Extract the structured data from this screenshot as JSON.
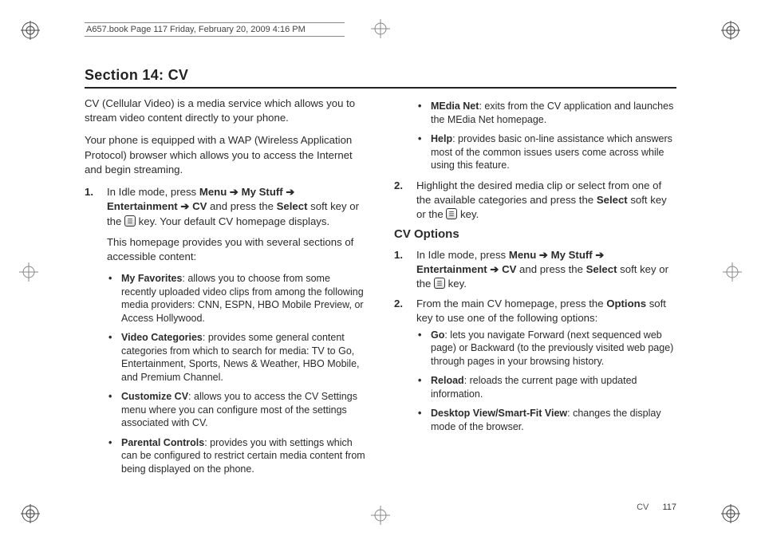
{
  "bookmeta": "A657.book  Page 117  Friday, February 20, 2009  4:16 PM",
  "section_title": "Section 14: CV",
  "intro1": "CV (Cellular Video) is a media service which allows you to stream video content directly to your phone.",
  "intro2": "Your phone is equipped with a WAP (Wireless Application Protocol) browser which allows you to access the Internet and begin streaming.",
  "step1": {
    "lead_a": "In Idle mode, press ",
    "menu": "Menu",
    "arrow": " ➔ ",
    "mystuff": "My Stuff",
    "entertainment": "Entertainment",
    "cv": "CV",
    "lead_b": " and press the ",
    "select": "Select",
    "lead_c": " soft key or the ",
    "lead_d": " key. Your default CV homepage displays.",
    "para2": "This homepage provides you with several sections of accessible content:"
  },
  "bullets_left": [
    {
      "label": "My Favorites",
      "text": ": allows you to choose from some recently uploaded video clips from among the following media providers: CNN, ESPN, HBO Mobile Preview, or Access Hollywood."
    },
    {
      "label": "Video Categories",
      "text": ": provides some general content categories from which to search for media: TV to Go, Entertainment, Sports, News & Weather, HBO Mobile, and Premium Channel."
    },
    {
      "label": "Customize CV",
      "text": ": allows you to access the CV Settings menu where you can configure most of the settings associated with CV."
    },
    {
      "label": "Parental Controls",
      "text": ": provides you with settings which can be configured to restrict certain media content from being displayed on the phone."
    }
  ],
  "bullets_right_top": [
    {
      "label": "MEdia Net",
      "text": ": exits from the CV application and launches the MEdia Net homepage."
    },
    {
      "label": "Help",
      "text": ": provides basic on-line assistance which answers most of the common issues users come across while using this feature."
    }
  ],
  "step2_right": {
    "a": "Highlight the desired media clip or select from one of the available categories and press the ",
    "select": "Select",
    "b": " soft key or the ",
    "c": " key."
  },
  "cv_options_title": "CV Options",
  "cvopt_step1": {
    "a": "In Idle mode, press ",
    "menu": "Menu",
    "arrow": " ➔ ",
    "mystuff": "My Stuff",
    "entertainment": "Entertainment",
    "cv": "CV",
    "b": " and press the ",
    "select": "Select",
    "c": " soft key or the ",
    "d": " key."
  },
  "cvopt_step2": {
    "a": "From the main CV homepage, press the ",
    "options": "Options",
    "b": " soft key to use one of the following options:"
  },
  "bullets_cvopt": [
    {
      "label": "Go",
      "text": ": lets you navigate Forward (next sequenced web page) or Backward (to the previously visited web page) through pages in your browsing history."
    },
    {
      "label": "Reload",
      "text": ": reloads the current page with updated information."
    },
    {
      "label": "Desktop View/Smart-Fit View",
      "text": ": changes the display mode of the browser."
    }
  ],
  "footer_label": "CV",
  "footer_page": "117"
}
